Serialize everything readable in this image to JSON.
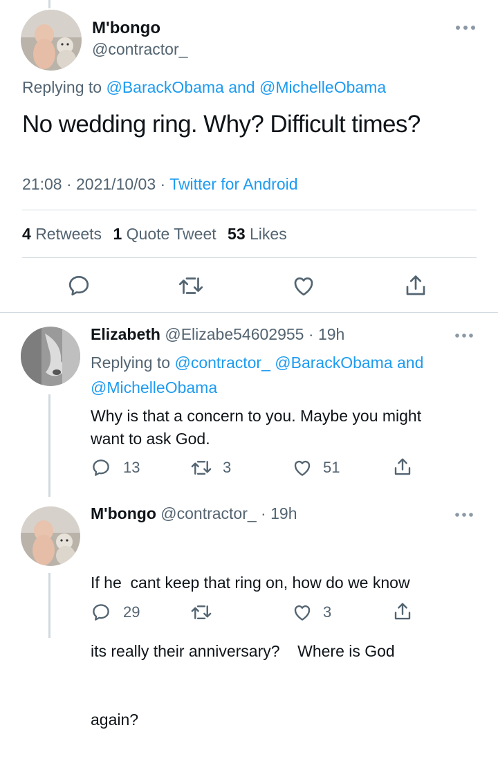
{
  "main_tweet": {
    "display_name": "M'bongo",
    "handle": "@contractor_",
    "replying_prefix": "Replying to",
    "replying_to_1": "@BarackObama",
    "replying_and": "and",
    "replying_to_2": "@MichelleObama",
    "text": "No wedding ring. Why? Difficult times?",
    "time": "21:08",
    "date": "2021/10/03",
    "source": "Twitter for Android",
    "retweets_count": "4",
    "retweets_label": "Retweets",
    "quotes_count": "1",
    "quotes_label": "Quote Tweet",
    "likes_count": "53",
    "likes_label": "Likes"
  },
  "replies": [
    {
      "display_name": "Elizabeth",
      "handle": "@Elizabe54602955",
      "time": "19h",
      "replying_prefix": "Replying to",
      "replying_to_1": "@contractor_",
      "replying_to_2": "@BarackObama",
      "replying_and": "and",
      "replying_to_3": "@MichelleObama",
      "text_line1": "Why is that a concern to you. Maybe you might",
      "text_line2": "want to ask God.",
      "reply_count": "13",
      "retweet_count": "3",
      "like_count": "51"
    },
    {
      "display_name": "M'bongo",
      "handle": "@contractor_",
      "time": "19h",
      "text_line1": "If he  cant keep that ring on, how do we know",
      "text_line2": "its really their anniversary?    Where is God",
      "text_line3": "again?",
      "reply_count": "29",
      "retweet_count": "",
      "like_count": "3"
    }
  ],
  "colors": {
    "link": "#1d9bf0",
    "secondary": "#536471",
    "divider": "#cfd9de"
  },
  "icons": [
    "more-icon",
    "reply-icon",
    "retweet-icon",
    "like-icon",
    "share-icon"
  ]
}
